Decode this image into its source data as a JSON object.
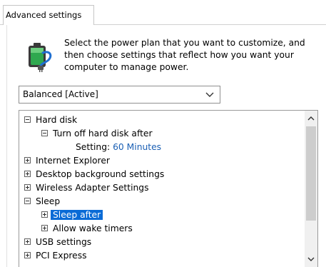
{
  "tabs": [
    {
      "label": "Advanced settings"
    }
  ],
  "header": {
    "icon": "power-plan-battery-icon",
    "instructions": "Select the power plan that you want to customize, and then choose settings that reflect how you want your computer to manage power."
  },
  "plan_select": {
    "selected": "Balanced [Active]"
  },
  "tree": {
    "items": [
      {
        "label": "Hard disk",
        "state": "expanded"
      },
      {
        "label": "Turn off hard disk after",
        "state": "expanded"
      },
      {
        "setting_label": "Setting:",
        "setting_value": "60 Minutes"
      },
      {
        "label": "Internet Explorer",
        "state": "collapsed"
      },
      {
        "label": "Desktop background settings",
        "state": "collapsed"
      },
      {
        "label": "Wireless Adapter Settings",
        "state": "collapsed"
      },
      {
        "label": "Sleep",
        "state": "expanded"
      },
      {
        "label": "Sleep after",
        "state": "collapsed",
        "selected": true
      },
      {
        "label": "Allow wake timers",
        "state": "collapsed"
      },
      {
        "label": "USB settings",
        "state": "collapsed"
      },
      {
        "label": "PCI Express",
        "state": "collapsed"
      }
    ]
  },
  "colors": {
    "selection": "#0a6bd6",
    "link": "#1a5fb4"
  }
}
